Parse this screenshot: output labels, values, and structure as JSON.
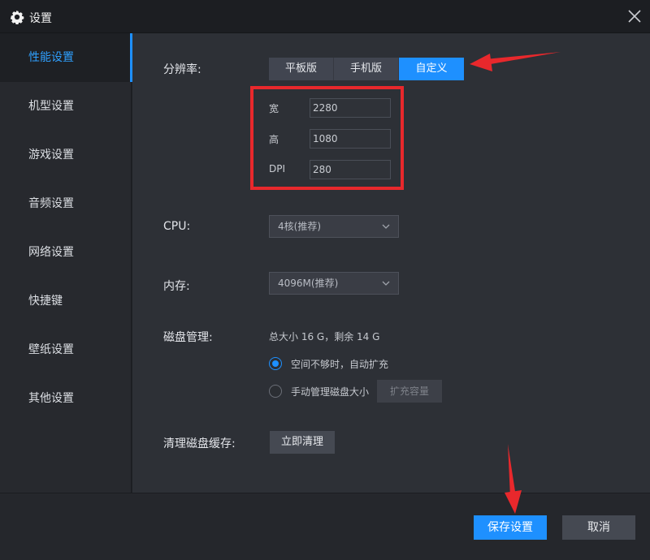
{
  "window": {
    "title": "设置",
    "icon": "gear-icon",
    "close_icon": "close-icon"
  },
  "sidebar": {
    "items": [
      {
        "label": "性能设置",
        "active": true
      },
      {
        "label": "机型设置"
      },
      {
        "label": "游戏设置"
      },
      {
        "label": "音频设置"
      },
      {
        "label": "网络设置"
      },
      {
        "label": "快捷键"
      },
      {
        "label": "壁纸设置"
      },
      {
        "label": "其他设置"
      }
    ]
  },
  "resolution": {
    "label": "分辨率:",
    "options": [
      "平板版",
      "手机版",
      "自定义"
    ],
    "selected": "自定义",
    "width_label": "宽",
    "width_value": "2280",
    "height_label": "高",
    "height_value": "1080",
    "dpi_label": "DPI",
    "dpi_value": "280"
  },
  "cpu": {
    "label": "CPU:",
    "value": "4核(推荐)"
  },
  "memory": {
    "label": "内存:",
    "value": "4096M(推荐)"
  },
  "disk": {
    "label": "磁盘管理:",
    "info": "总大小 16 G，剩余 14 G",
    "option_auto": "空间不够时，自动扩充",
    "option_manual": "手动管理磁盘大小",
    "expand_button": "扩充容量"
  },
  "cache": {
    "label": "清理磁盘缓存:",
    "button": "立即清理"
  },
  "footer": {
    "save": "保存设置",
    "cancel": "取消"
  },
  "colors": {
    "accent": "#1e90ff",
    "annotation_red": "#e8282c"
  }
}
